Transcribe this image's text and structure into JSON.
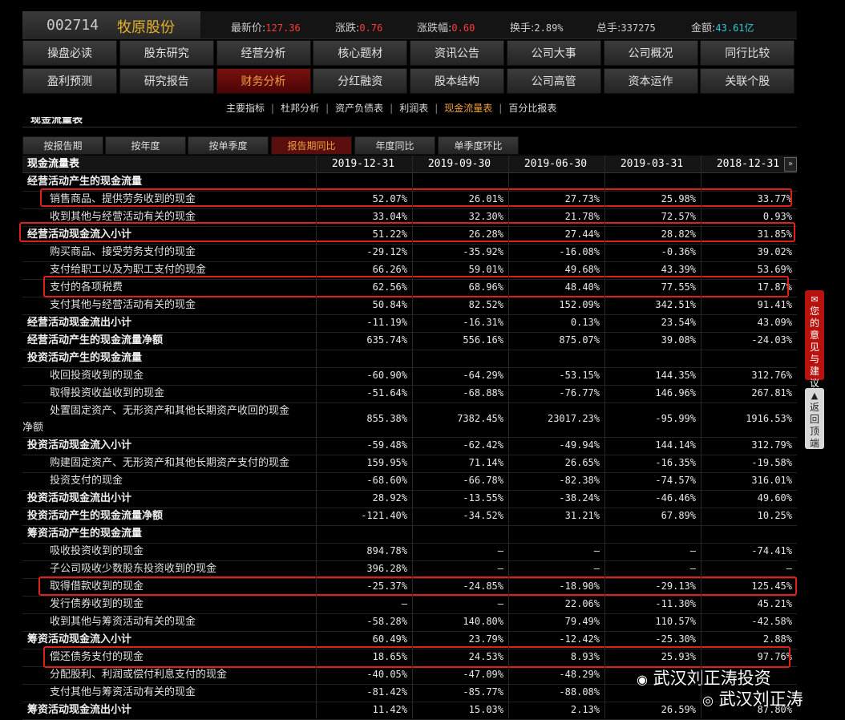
{
  "stock": {
    "code": "002714",
    "name": "牧原股份"
  },
  "quote": [
    {
      "label": "最新价:",
      "value": "127.36",
      "color": "red"
    },
    {
      "label": "涨跌:",
      "value": "0.76",
      "color": "red"
    },
    {
      "label": "涨跌幅:",
      "value": "0.60",
      "color": "red"
    },
    {
      "label": "换手:",
      "value": "2.89%",
      "color": ""
    },
    {
      "label": "总手:",
      "value": "337275",
      "color": ""
    },
    {
      "label": "金额:",
      "value": "43.61亿",
      "color": "cyan"
    }
  ],
  "nav_row1": [
    "操盘必读",
    "股东研究",
    "经营分析",
    "核心题材",
    "资讯公告",
    "公司大事",
    "公司概况",
    "同行比较"
  ],
  "nav_row2": [
    "盈利预测",
    "研究报告",
    "财务分析",
    "分红融资",
    "股本结构",
    "公司高管",
    "资本运作",
    "关联个股"
  ],
  "nav_active": "财务分析",
  "subnav": [
    "主要指标",
    "杜邦分析",
    "资产负债表",
    "利润表",
    "现金流量表",
    "百分比报表"
  ],
  "subnav_active": "现金流量表",
  "section_title": "现金流量表",
  "tabs": [
    "按报告期",
    "按年度",
    "按单季度",
    "报告期同比",
    "年度同比",
    "单季度环比"
  ],
  "tab_active": "报告期同比",
  "table": {
    "header_label": "现金流量表",
    "dates": [
      "2019-12-31",
      "2019-09-30",
      "2019-06-30",
      "2019-03-31",
      "2018-12-31"
    ],
    "rows": [
      {
        "label": "经营活动产生的现金流量",
        "level": 1,
        "values": [
          "",
          "",
          "",
          "",
          ""
        ]
      },
      {
        "label": "销售商品、提供劳务收到的现金",
        "level": 2,
        "values": [
          "52.07%",
          "26.01%",
          "27.73%",
          "25.98%",
          "33.77%"
        ]
      },
      {
        "label": "收到其他与经营活动有关的现金",
        "level": 2,
        "values": [
          "33.04%",
          "32.30%",
          "21.78%",
          "72.57%",
          "0.93%"
        ]
      },
      {
        "label": "经营活动现金流入小计",
        "level": 1,
        "values": [
          "51.22%",
          "26.28%",
          "27.44%",
          "28.82%",
          "31.85%"
        ]
      },
      {
        "label": "购买商品、接受劳务支付的现金",
        "level": 2,
        "values": [
          "-29.12%",
          "-35.92%",
          "-16.08%",
          "-0.36%",
          "39.02%"
        ]
      },
      {
        "label": "支付给职工以及为职工支付的现金",
        "level": 2,
        "values": [
          "66.26%",
          "59.01%",
          "49.68%",
          "43.39%",
          "53.69%"
        ]
      },
      {
        "label": "支付的各项税费",
        "level": 2,
        "values": [
          "62.56%",
          "68.96%",
          "48.40%",
          "77.55%",
          "17.87%"
        ]
      },
      {
        "label": "支付其他与经营活动有关的现金",
        "level": 2,
        "values": [
          "50.84%",
          "82.52%",
          "152.09%",
          "342.51%",
          "91.41%"
        ]
      },
      {
        "label": "经营活动现金流出小计",
        "level": 1,
        "values": [
          "-11.19%",
          "-16.31%",
          "0.13%",
          "23.54%",
          "43.09%"
        ]
      },
      {
        "label": "经营活动产生的现金流量净额",
        "level": 1,
        "values": [
          "635.74%",
          "556.16%",
          "875.07%",
          "39.08%",
          "-24.03%"
        ]
      },
      {
        "label": "投资活动产生的现金流量",
        "level": 1,
        "values": [
          "",
          "",
          "",
          "",
          ""
        ]
      },
      {
        "label": "收回投资收到的现金",
        "level": 2,
        "values": [
          "-60.90%",
          "-64.29%",
          "-53.15%",
          "144.35%",
          "312.76%"
        ]
      },
      {
        "label": "取得投资收益收到的现金",
        "level": 2,
        "values": [
          "-51.64%",
          "-68.88%",
          "-76.77%",
          "146.96%",
          "267.81%"
        ]
      },
      {
        "label": "处置固定资产、无形资产和其他长期资产收回的现金",
        "label2": "净额",
        "level": 2,
        "values": [
          "855.38%",
          "7382.45%",
          "23017.23%",
          "-95.99%",
          "1916.53%"
        ]
      },
      {
        "label": "投资活动现金流入小计",
        "level": 1,
        "values": [
          "-59.48%",
          "-62.42%",
          "-49.94%",
          "144.14%",
          "312.79%"
        ]
      },
      {
        "label": "购建固定资产、无形资产和其他长期资产支付的现金",
        "level": 2,
        "values": [
          "159.95%",
          "71.14%",
          "26.65%",
          "-16.35%",
          "-19.58%"
        ]
      },
      {
        "label": "投资支付的现金",
        "level": 2,
        "values": [
          "-68.60%",
          "-66.78%",
          "-82.38%",
          "-74.57%",
          "316.01%"
        ]
      },
      {
        "label": "投资活动现金流出小计",
        "level": 1,
        "values": [
          "28.92%",
          "-13.55%",
          "-38.24%",
          "-46.46%",
          "49.60%"
        ]
      },
      {
        "label": "投资活动产生的现金流量净额",
        "level": 1,
        "values": [
          "-121.40%",
          "-34.52%",
          "31.21%",
          "67.89%",
          "10.25%"
        ]
      },
      {
        "label": "筹资活动产生的现金流量",
        "level": 1,
        "values": [
          "",
          "",
          "",
          "",
          ""
        ]
      },
      {
        "label": "吸收投资收到的现金",
        "level": 2,
        "values": [
          "894.78%",
          "—",
          "—",
          "—",
          "-74.41%"
        ]
      },
      {
        "label": "子公司吸收少数股东投资收到的现金",
        "level": 2,
        "values": [
          "396.28%",
          "—",
          "—",
          "—",
          "—"
        ]
      },
      {
        "label": "取得借款收到的现金",
        "level": 2,
        "values": [
          "-25.37%",
          "-24.85%",
          "-18.90%",
          "-29.13%",
          "125.45%"
        ]
      },
      {
        "label": "发行债券收到的现金",
        "level": 2,
        "values": [
          "—",
          "—",
          "22.06%",
          "-11.30%",
          "45.21%"
        ]
      },
      {
        "label": "收到其他与筹资活动有关的现金",
        "level": 2,
        "values": [
          "-58.28%",
          "140.80%",
          "79.49%",
          "110.57%",
          "-42.58%"
        ]
      },
      {
        "label": "筹资活动现金流入小计",
        "level": 1,
        "values": [
          "60.49%",
          "23.79%",
          "-12.42%",
          "-25.30%",
          "2.88%"
        ]
      },
      {
        "label": "偿还债务支付的现金",
        "level": 2,
        "values": [
          "18.65%",
          "24.53%",
          "8.93%",
          "25.93%",
          "97.76%"
        ]
      },
      {
        "label": "分配股利、利润或偿付利息支付的现金",
        "level": 2,
        "values": [
          "-40.05%",
          "-47.09%",
          "-48.29%",
          "",
          ""
        ]
      },
      {
        "label": "支付其他与筹资活动有关的现金",
        "level": 2,
        "values": [
          "-81.42%",
          "-85.77%",
          "-88.08%",
          "",
          ""
        ]
      },
      {
        "label": "筹资活动现金流出小计",
        "level": 1,
        "values": [
          "11.42%",
          "15.03%",
          "2.13%",
          "26.59%",
          "87.80%"
        ]
      }
    ]
  },
  "highlight_color": "#e0211b",
  "feedback_label": "您的意见与建议",
  "backtop_label": "返回顶端",
  "watermark": {
    "line1": "武汉刘正涛投资",
    "line2": "武汉刘正涛"
  }
}
